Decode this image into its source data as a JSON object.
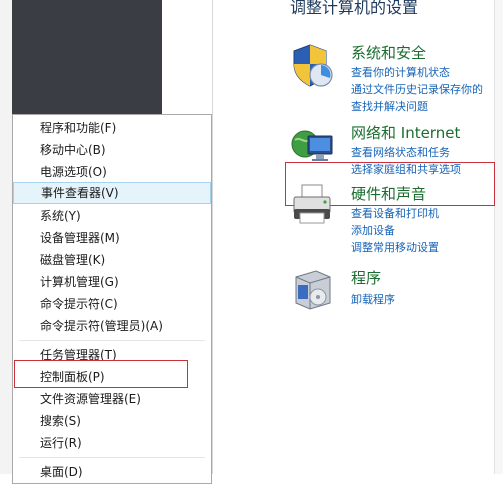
{
  "control_panel": {
    "heading": "调整计算机的设置",
    "categories": [
      {
        "title": "系统和安全",
        "links": [
          "查看你的计算机状态",
          "通过文件历史记录保存你的",
          "查找并解决问题"
        ]
      },
      {
        "title": "网络和 Internet",
        "links": [
          "查看网络状态和任务",
          "选择家庭组和共享选项"
        ]
      },
      {
        "title": "硬件和声音",
        "links": [
          "查看设备和打印机",
          "添加设备",
          "调整常用移动设置"
        ]
      },
      {
        "title": "程序",
        "links": [
          "卸载程序"
        ]
      }
    ]
  },
  "context_menu": {
    "items": [
      "程序和功能(F)",
      "移动中心(B)",
      "电源选项(O)",
      "事件查看器(V)",
      "系统(Y)",
      "设备管理器(M)",
      "磁盘管理(K)",
      "计算机管理(G)",
      "命令提示符(C)",
      "命令提示符(管理员)(A)",
      "任务管理器(T)",
      "控制面板(P)",
      "文件资源管理器(E)",
      "搜索(S)",
      "运行(R)",
      "桌面(D)"
    ],
    "highlighted": "事件查看器(V)"
  },
  "colors": {
    "highlight_box": "#c8323c",
    "category_title": "#1b6d2f",
    "link": "#1563b7"
  }
}
